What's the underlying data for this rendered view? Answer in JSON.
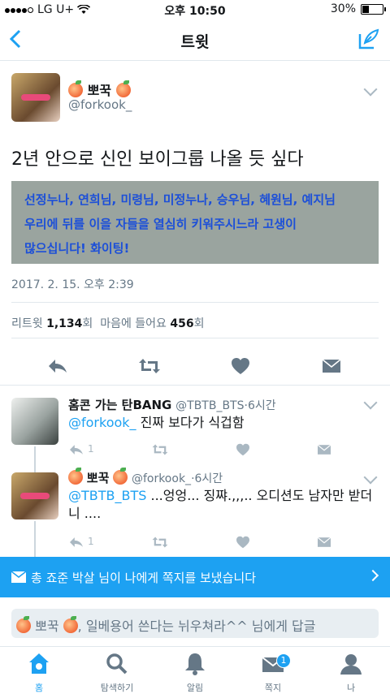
{
  "status_bar": {
    "carrier": "LG U+",
    "time": "오후 10:50",
    "battery": "30%",
    "battery_level": 0.3
  },
  "nav": {
    "title": "트윗"
  },
  "tweet": {
    "name": "뽀꾹",
    "handle": "@forkook_",
    "text": "2년 안으로 신인 보이그룹 나올 듯 싶다",
    "media_lines": [
      "선정누나, 연희님, 미령님, 미정누나, 승우님, 혜원님, 예지님",
      "우리에 뒤를 이을 자들을 열심히 키워주시느라 고생이",
      "많으십니다! 화이팅!"
    ],
    "date": "2017. 2. 15. 오후 2:39",
    "retweet_label": "리트윗",
    "retweet_count": "1,134",
    "retweet_unit": "회",
    "like_label": "마음에 들어요",
    "like_count": "456",
    "like_unit": "회"
  },
  "replies": [
    {
      "name": "홈콘 가는 탄BANG",
      "handle": "@TBTB_BTS",
      "time": "6시간",
      "mention": "@forkook_",
      "text": "진짜 보다가 식겁함",
      "reply_count": "1"
    },
    {
      "name": "뽀꾹",
      "handle": "@forkook_",
      "time": "6시간",
      "mention": "@TBTB_BTS",
      "text": "...엉엉... 징쨔.,,,.. 오디션도 남자만 받더니 ....",
      "reply_count": "1"
    }
  ],
  "banner": {
    "text": "총 죠준 박살 님이 나에게 쪽지를 보냈습니다"
  },
  "composer": {
    "name": "뽀꾹",
    "text": ", 일베용어 쓴다는 뉘우쳐라^^ 님에게 답글"
  },
  "tabs": [
    {
      "label": "홈"
    },
    {
      "label": "탐색하기"
    },
    {
      "label": "알림"
    },
    {
      "label": "쪽지",
      "badge": "1"
    },
    {
      "label": "나"
    }
  ],
  "colors": {
    "accent": "#1da1f2",
    "muted": "#657786",
    "mention": "#1da1f2"
  }
}
